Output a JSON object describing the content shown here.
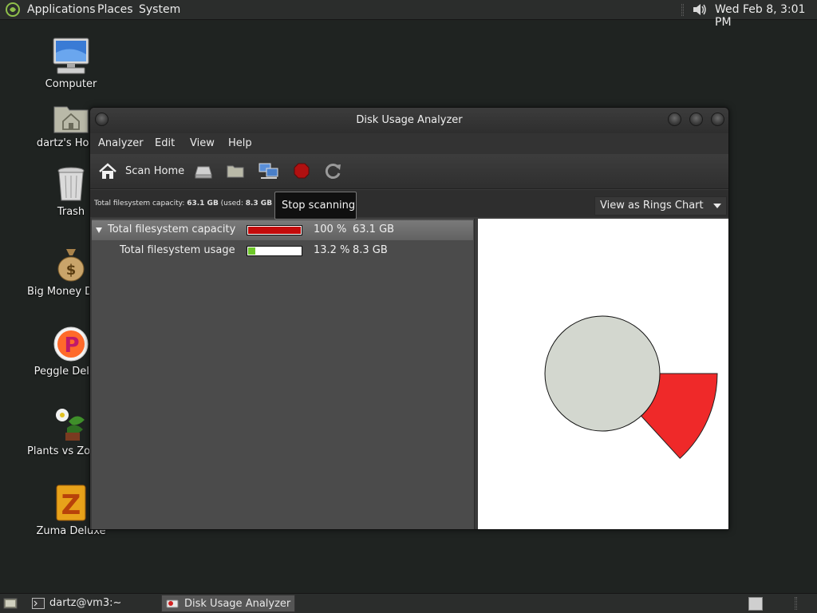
{
  "top_panel": {
    "applications": "Applications",
    "places": "Places",
    "system": "System",
    "clock": "Wed Feb  8,  3:01 PM"
  },
  "desktop": {
    "icons": [
      {
        "label": "Computer",
        "icon": "computer-icon"
      },
      {
        "label": "dartz's Home",
        "icon": "home-folder-icon"
      },
      {
        "label": "Trash",
        "icon": "trash-icon"
      },
      {
        "label": "Big Money Deluxe",
        "icon": "money-bag-icon"
      },
      {
        "label": "Peggle Deluxe",
        "icon": "peggle-icon"
      },
      {
        "label": "Plants vs Zombies",
        "icon": "plants-icon"
      },
      {
        "label": "Zuma Deluxe",
        "icon": "zuma-icon"
      }
    ]
  },
  "window": {
    "title": "Disk Usage Analyzer",
    "menu": {
      "analyzer": "Analyzer",
      "edit": "Edit",
      "view": "View",
      "help": "Help"
    },
    "toolbar": {
      "scan_home": "Scan Home"
    },
    "tooltip": "Stop scanning",
    "info": {
      "prefix": "Total filesystem capacity: ",
      "capacity": "63.1 GB",
      "used_prefix": " (used: ",
      "used": "8.3 GB"
    },
    "view_select": {
      "selected": "View as Rings Chart"
    },
    "tree": [
      {
        "name": "Total filesystem capacity",
        "percent": "100 %",
        "size": "63.1 GB",
        "fill_fraction": 1.0,
        "fill_color": "#c30b0b"
      },
      {
        "name": "Total filesystem usage",
        "percent": "13.2 %",
        "size": "8.3 GB",
        "fill_fraction": 0.132,
        "fill_color": "#6ec72a"
      }
    ]
  },
  "chart_data": {
    "type": "pie",
    "center_label": "",
    "segments": [
      {
        "name": "Total filesystem usage",
        "fraction": 0.132,
        "color": "#ef2929"
      }
    ],
    "center_color": "#d3d7cf"
  },
  "taskbar": {
    "terminal": "dartz@vm3:~",
    "dua": "Disk Usage Analyzer"
  },
  "colors": {
    "desktop_bg": "#1f2321",
    "panel_bg": "#2b2d2c",
    "usage_red": "#ef2929"
  }
}
